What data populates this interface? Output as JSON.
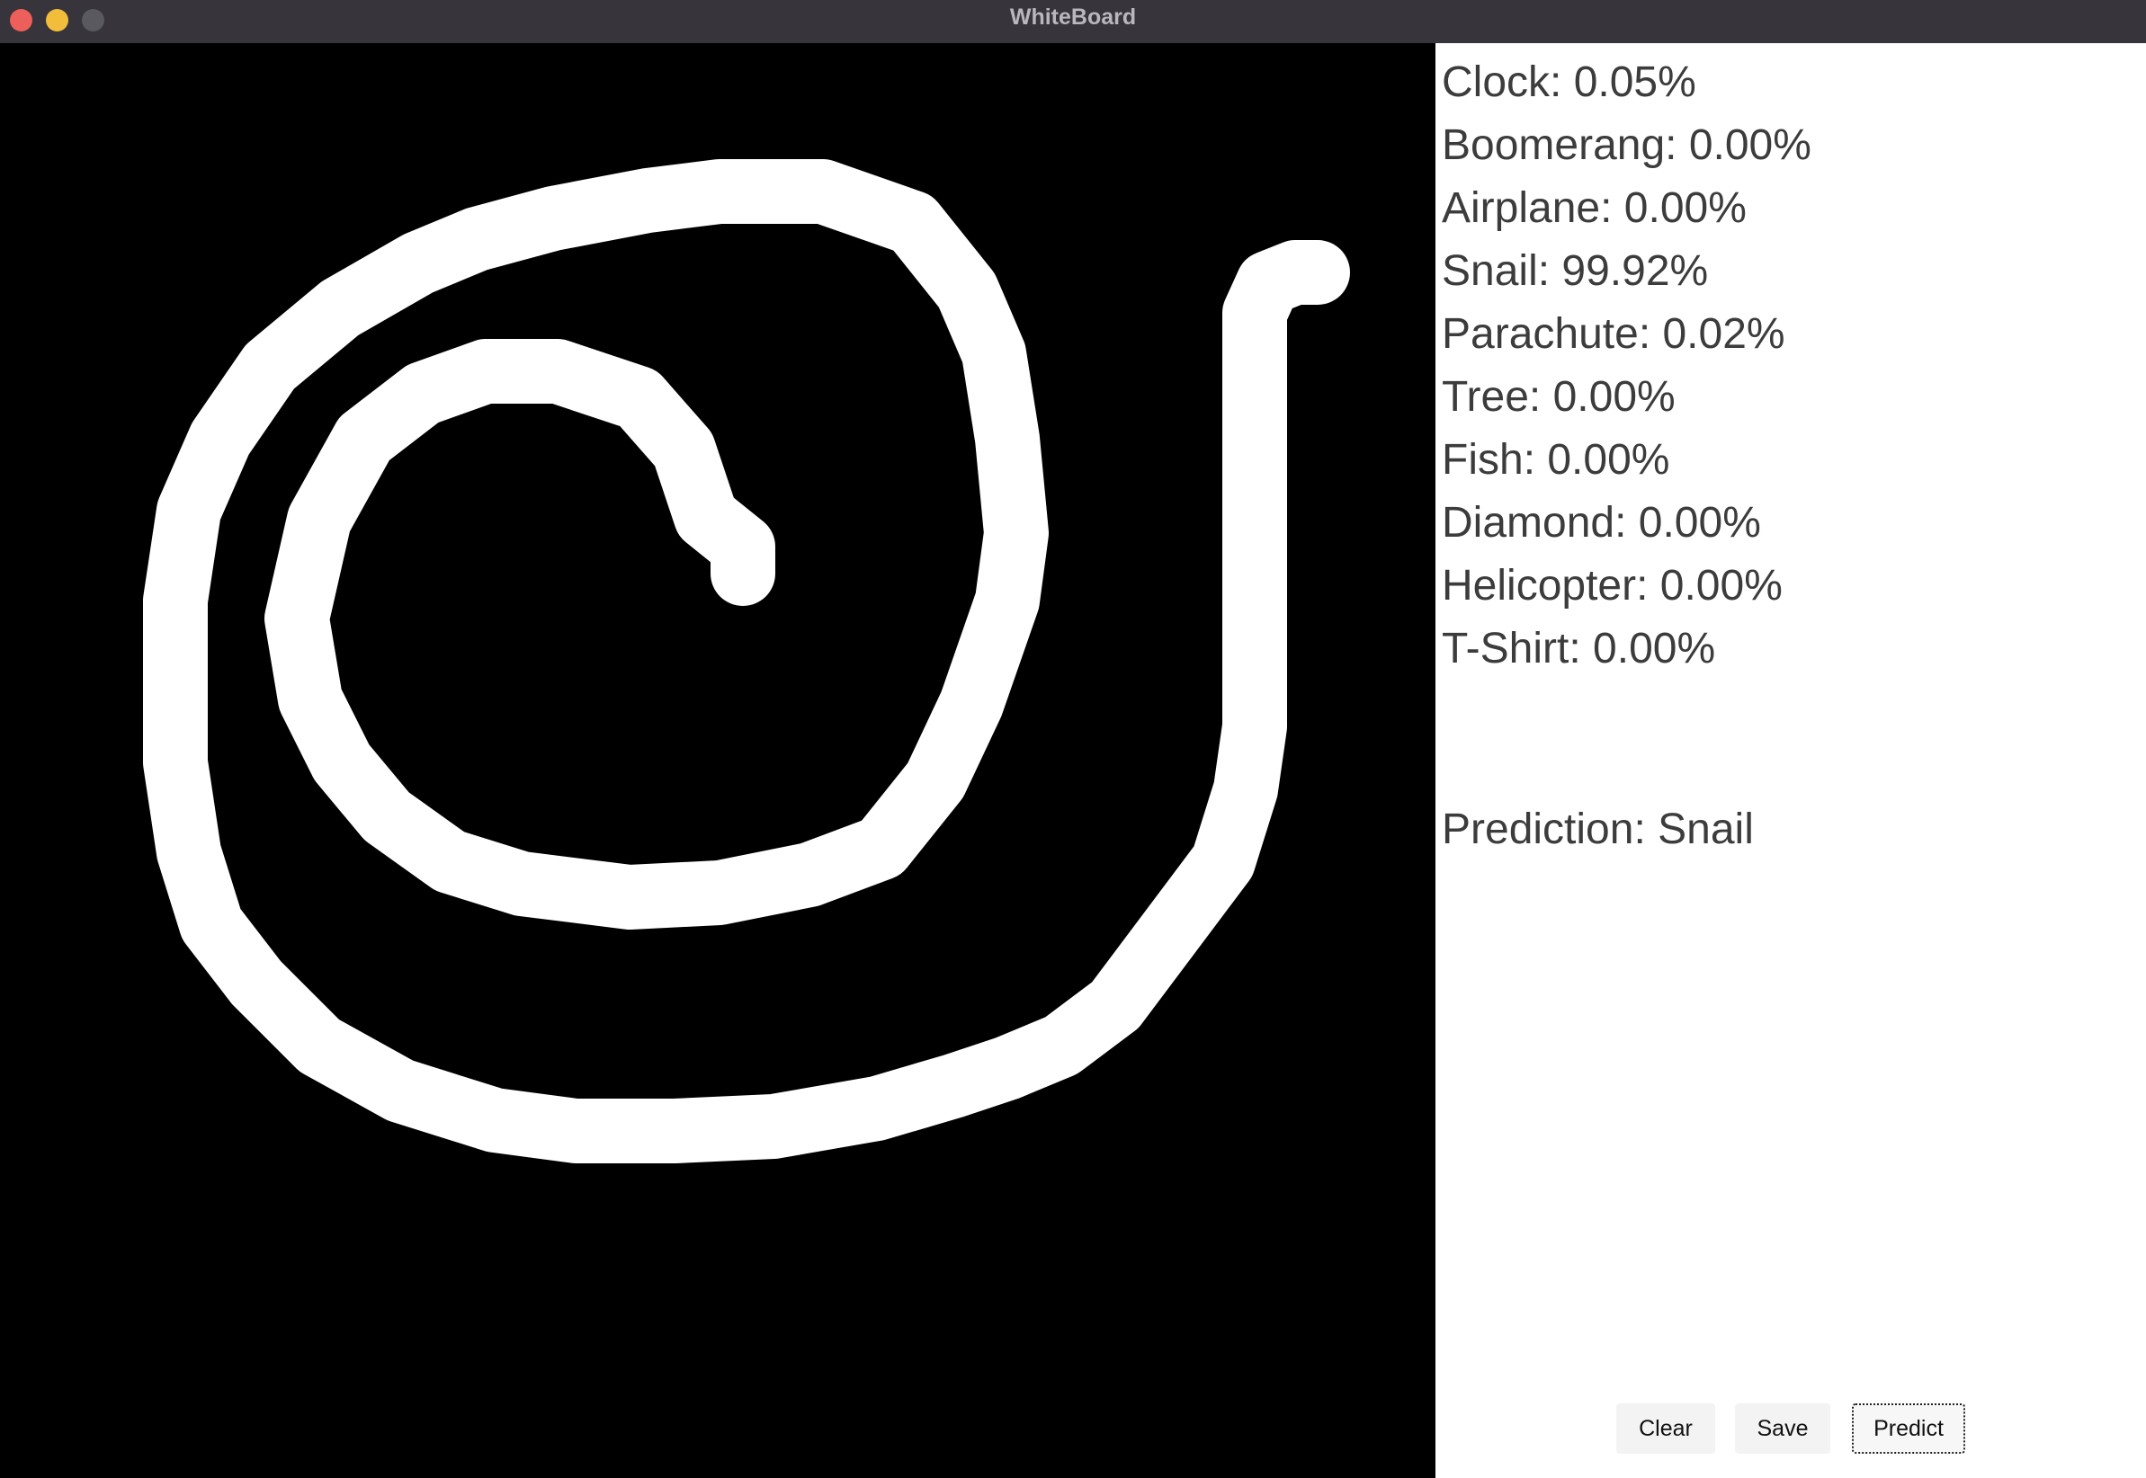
{
  "window": {
    "title": "WhiteBoard"
  },
  "scores": [
    {
      "label": "Clock",
      "value": "0.05%"
    },
    {
      "label": "Boomerang",
      "value": "0.00%"
    },
    {
      "label": "Airplane",
      "value": "0.00%"
    },
    {
      "label": "Snail",
      "value": "99.92%"
    },
    {
      "label": "Parachute",
      "value": "0.02%"
    },
    {
      "label": "Tree",
      "value": "0.00%"
    },
    {
      "label": "Fish",
      "value": "0.00%"
    },
    {
      "label": "Diamond",
      "value": "0.00%"
    },
    {
      "label": "Helicopter",
      "value": "0.00%"
    },
    {
      "label": "T-Shirt",
      "value": "0.00%"
    }
  ],
  "prediction": {
    "label": "Prediction",
    "value": "Snail"
  },
  "buttons": {
    "clear": "Clear",
    "save": "Save",
    "predict": "Predict"
  },
  "colors": {
    "canvas_bg": "#000000",
    "stroke": "#ffffff",
    "titlebar": "#37343b",
    "close": "#ec5f5a",
    "minimize": "#f1bd3b",
    "maximize": "#5b5960"
  }
}
